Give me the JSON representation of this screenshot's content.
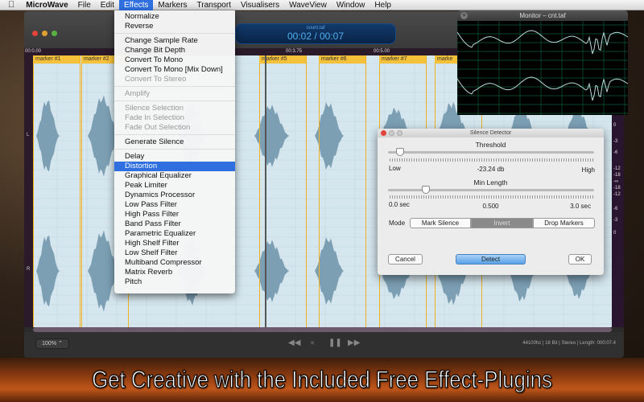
{
  "menubar": {
    "apple": "",
    "app": "MicroWave",
    "items": [
      "File",
      "Edit",
      "Effects",
      "Markers",
      "Transport",
      "Visualisers",
      "WaveView",
      "Window",
      "Help"
    ],
    "active": "Effects"
  },
  "lcd": {
    "file": "count.taf",
    "time": "00:02 / 00:07"
  },
  "ruler": [
    "00:0.00",
    "00:3.75",
    "00:5.00"
  ],
  "markers": [
    "marker #1",
    "marker #2",
    "marker #5",
    "marker #6",
    "marker #7",
    "marke"
  ],
  "channels": {
    "left": "L",
    "right": "R"
  },
  "meter": [
    "-∞",
    "-18",
    "-12",
    "-6",
    "-3",
    "0",
    "-3",
    "-6",
    "-12",
    "-18",
    "-∞",
    "-18",
    "-12",
    "-6",
    "-3",
    "0"
  ],
  "bottom": {
    "zoom": "100% ⌃",
    "rewind": "◀◀",
    "record": "●",
    "pause": "❚❚",
    "forward": "▶▶",
    "status": "44100hz | 16 Bit | Stereo | Length: 000:07.4"
  },
  "effects_menu": [
    {
      "label": "Normalize"
    },
    {
      "label": "Reverse"
    },
    {
      "sep": true
    },
    {
      "label": "Change Sample Rate"
    },
    {
      "label": "Change Bit Depth"
    },
    {
      "label": "Convert To Mono"
    },
    {
      "label": "Convert To Mono [Mix Down]"
    },
    {
      "label": "Convert To Stereo",
      "disabled": true
    },
    {
      "sep": true
    },
    {
      "label": "Amplify",
      "disabled": true
    },
    {
      "sep": true
    },
    {
      "label": "Silence Selection",
      "disabled": true
    },
    {
      "label": "Fade In Selection",
      "disabled": true
    },
    {
      "label": "Fade Out Selection",
      "disabled": true
    },
    {
      "sep": true
    },
    {
      "label": "Generate Silence"
    },
    {
      "sep": true
    },
    {
      "label": "Delay"
    },
    {
      "label": "Distortion",
      "selected": true
    },
    {
      "label": "Graphical Equalizer"
    },
    {
      "label": "Peak Limiter"
    },
    {
      "label": "Dynamics Processor"
    },
    {
      "label": "Low Pass Filter"
    },
    {
      "label": "High Pass Filter"
    },
    {
      "label": "Band Pass Filter"
    },
    {
      "label": "Parametric Equalizer"
    },
    {
      "label": "High Shelf Filter"
    },
    {
      "label": "Low Shelf Filter"
    },
    {
      "label": "Multiband Compressor"
    },
    {
      "label": "Matrix Reverb"
    },
    {
      "label": "Pitch"
    }
  ],
  "monitor": {
    "title": "Monitor – cnt.taf"
  },
  "silence_detector": {
    "title": "Silence Detector",
    "threshold_label": "Threshold",
    "threshold_low": "Low",
    "threshold_value": "-23.24 db",
    "threshold_high": "High",
    "threshold_fraction": 0.04,
    "minlength_label": "Min Length",
    "minlength_min": "0.0 sec",
    "minlength_value": "0.500",
    "minlength_max": "3.0 sec",
    "minlength_fraction": 0.17,
    "mode_label": "Mode",
    "modes": [
      "Mark Silence",
      "Invert",
      "Drop Markers"
    ],
    "selected_mode": "Invert",
    "cancel": "Cancel",
    "detect": "Detect",
    "ok": "OK"
  },
  "caption": "Get Creative with the Included Free Effect-Plugins",
  "colors": {
    "accent": "#2f6fe0",
    "marker": "#f5c03a",
    "waveform": "#7c9fb4",
    "meter_bg": "#2a1530"
  }
}
